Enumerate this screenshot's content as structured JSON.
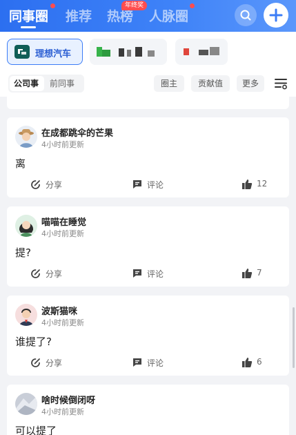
{
  "nav": {
    "tabs": [
      {
        "label": "同事圈",
        "active": true,
        "dot": true
      },
      {
        "label": "推荐",
        "active": false
      },
      {
        "label": "热榜",
        "active": false,
        "badge": "年终奖"
      },
      {
        "label": "人脉圈",
        "active": false,
        "dot": true
      }
    ],
    "search_icon": "search-icon",
    "add_icon": "plus-icon",
    "accent": "#3b7cf6"
  },
  "companies": [
    {
      "name": "理想汽车",
      "active": true
    }
  ],
  "filter": {
    "segments": [
      "公司事",
      "前同事"
    ],
    "buttons": [
      "圈主",
      "贡献值",
      "更多"
    ],
    "menu_icon": "filter-list-icon"
  },
  "posts": [
    {
      "author": "在成都跳伞的芒果",
      "time": "4小时前更新",
      "content": "离",
      "share": "分享",
      "comment": "评论",
      "likes": "12"
    },
    {
      "author": "喵喵在睡觉",
      "time": "4小时前更新",
      "content": "提?",
      "share": "分享",
      "comment": "评论",
      "likes": "7"
    },
    {
      "author": "波斯猫咪",
      "time": "4小时前更新",
      "content": "谁提了?",
      "share": "分享",
      "comment": "评论",
      "likes": "6"
    },
    {
      "author": "啥时候倒闭呀",
      "time": "4小时前更新",
      "content": "可以提了"
    }
  ]
}
